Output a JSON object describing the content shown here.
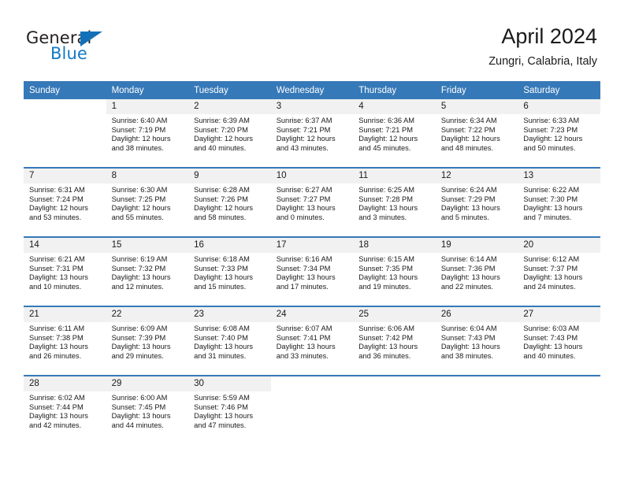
{
  "brand": {
    "name_top": "General",
    "name_bottom": "Blue",
    "accent_color": "#1479c4",
    "triangle_color": "#1470b8"
  },
  "header": {
    "title": "April 2024",
    "subtitle": "Zungri, Calabria, Italy"
  },
  "theme": {
    "header_row_bg": "#3679b8",
    "daynum_bg": "#f1f1f1",
    "text_color": "#1a1a1a"
  },
  "weekday_headers": [
    "Sunday",
    "Monday",
    "Tuesday",
    "Wednesday",
    "Thursday",
    "Friday",
    "Saturday"
  ],
  "weeks": [
    [
      {
        "day": "",
        "sunrise": "",
        "sunset": "",
        "daylight": ""
      },
      {
        "day": "1",
        "sunrise": "Sunrise: 6:40 AM",
        "sunset": "Sunset: 7:19 PM",
        "daylight": "Daylight: 12 hours and 38 minutes."
      },
      {
        "day": "2",
        "sunrise": "Sunrise: 6:39 AM",
        "sunset": "Sunset: 7:20 PM",
        "daylight": "Daylight: 12 hours and 40 minutes."
      },
      {
        "day": "3",
        "sunrise": "Sunrise: 6:37 AM",
        "sunset": "Sunset: 7:21 PM",
        "daylight": "Daylight: 12 hours and 43 minutes."
      },
      {
        "day": "4",
        "sunrise": "Sunrise: 6:36 AM",
        "sunset": "Sunset: 7:21 PM",
        "daylight": "Daylight: 12 hours and 45 minutes."
      },
      {
        "day": "5",
        "sunrise": "Sunrise: 6:34 AM",
        "sunset": "Sunset: 7:22 PM",
        "daylight": "Daylight: 12 hours and 48 minutes."
      },
      {
        "day": "6",
        "sunrise": "Sunrise: 6:33 AM",
        "sunset": "Sunset: 7:23 PM",
        "daylight": "Daylight: 12 hours and 50 minutes."
      }
    ],
    [
      {
        "day": "7",
        "sunrise": "Sunrise: 6:31 AM",
        "sunset": "Sunset: 7:24 PM",
        "daylight": "Daylight: 12 hours and 53 minutes."
      },
      {
        "day": "8",
        "sunrise": "Sunrise: 6:30 AM",
        "sunset": "Sunset: 7:25 PM",
        "daylight": "Daylight: 12 hours and 55 minutes."
      },
      {
        "day": "9",
        "sunrise": "Sunrise: 6:28 AM",
        "sunset": "Sunset: 7:26 PM",
        "daylight": "Daylight: 12 hours and 58 minutes."
      },
      {
        "day": "10",
        "sunrise": "Sunrise: 6:27 AM",
        "sunset": "Sunset: 7:27 PM",
        "daylight": "Daylight: 13 hours and 0 minutes."
      },
      {
        "day": "11",
        "sunrise": "Sunrise: 6:25 AM",
        "sunset": "Sunset: 7:28 PM",
        "daylight": "Daylight: 13 hours and 3 minutes."
      },
      {
        "day": "12",
        "sunrise": "Sunrise: 6:24 AM",
        "sunset": "Sunset: 7:29 PM",
        "daylight": "Daylight: 13 hours and 5 minutes."
      },
      {
        "day": "13",
        "sunrise": "Sunrise: 6:22 AM",
        "sunset": "Sunset: 7:30 PM",
        "daylight": "Daylight: 13 hours and 7 minutes."
      }
    ],
    [
      {
        "day": "14",
        "sunrise": "Sunrise: 6:21 AM",
        "sunset": "Sunset: 7:31 PM",
        "daylight": "Daylight: 13 hours and 10 minutes."
      },
      {
        "day": "15",
        "sunrise": "Sunrise: 6:19 AM",
        "sunset": "Sunset: 7:32 PM",
        "daylight": "Daylight: 13 hours and 12 minutes."
      },
      {
        "day": "16",
        "sunrise": "Sunrise: 6:18 AM",
        "sunset": "Sunset: 7:33 PM",
        "daylight": "Daylight: 13 hours and 15 minutes."
      },
      {
        "day": "17",
        "sunrise": "Sunrise: 6:16 AM",
        "sunset": "Sunset: 7:34 PM",
        "daylight": "Daylight: 13 hours and 17 minutes."
      },
      {
        "day": "18",
        "sunrise": "Sunrise: 6:15 AM",
        "sunset": "Sunset: 7:35 PM",
        "daylight": "Daylight: 13 hours and 19 minutes."
      },
      {
        "day": "19",
        "sunrise": "Sunrise: 6:14 AM",
        "sunset": "Sunset: 7:36 PM",
        "daylight": "Daylight: 13 hours and 22 minutes."
      },
      {
        "day": "20",
        "sunrise": "Sunrise: 6:12 AM",
        "sunset": "Sunset: 7:37 PM",
        "daylight": "Daylight: 13 hours and 24 minutes."
      }
    ],
    [
      {
        "day": "21",
        "sunrise": "Sunrise: 6:11 AM",
        "sunset": "Sunset: 7:38 PM",
        "daylight": "Daylight: 13 hours and 26 minutes."
      },
      {
        "day": "22",
        "sunrise": "Sunrise: 6:09 AM",
        "sunset": "Sunset: 7:39 PM",
        "daylight": "Daylight: 13 hours and 29 minutes."
      },
      {
        "day": "23",
        "sunrise": "Sunrise: 6:08 AM",
        "sunset": "Sunset: 7:40 PM",
        "daylight": "Daylight: 13 hours and 31 minutes."
      },
      {
        "day": "24",
        "sunrise": "Sunrise: 6:07 AM",
        "sunset": "Sunset: 7:41 PM",
        "daylight": "Daylight: 13 hours and 33 minutes."
      },
      {
        "day": "25",
        "sunrise": "Sunrise: 6:06 AM",
        "sunset": "Sunset: 7:42 PM",
        "daylight": "Daylight: 13 hours and 36 minutes."
      },
      {
        "day": "26",
        "sunrise": "Sunrise: 6:04 AM",
        "sunset": "Sunset: 7:43 PM",
        "daylight": "Daylight: 13 hours and 38 minutes."
      },
      {
        "day": "27",
        "sunrise": "Sunrise: 6:03 AM",
        "sunset": "Sunset: 7:43 PM",
        "daylight": "Daylight: 13 hours and 40 minutes."
      }
    ],
    [
      {
        "day": "28",
        "sunrise": "Sunrise: 6:02 AM",
        "sunset": "Sunset: 7:44 PM",
        "daylight": "Daylight: 13 hours and 42 minutes."
      },
      {
        "day": "29",
        "sunrise": "Sunrise: 6:00 AM",
        "sunset": "Sunset: 7:45 PM",
        "daylight": "Daylight: 13 hours and 44 minutes."
      },
      {
        "day": "30",
        "sunrise": "Sunrise: 5:59 AM",
        "sunset": "Sunset: 7:46 PM",
        "daylight": "Daylight: 13 hours and 47 minutes."
      },
      {
        "day": "",
        "sunrise": "",
        "sunset": "",
        "daylight": ""
      },
      {
        "day": "",
        "sunrise": "",
        "sunset": "",
        "daylight": ""
      },
      {
        "day": "",
        "sunrise": "",
        "sunset": "",
        "daylight": ""
      },
      {
        "day": "",
        "sunrise": "",
        "sunset": "",
        "daylight": ""
      }
    ]
  ]
}
